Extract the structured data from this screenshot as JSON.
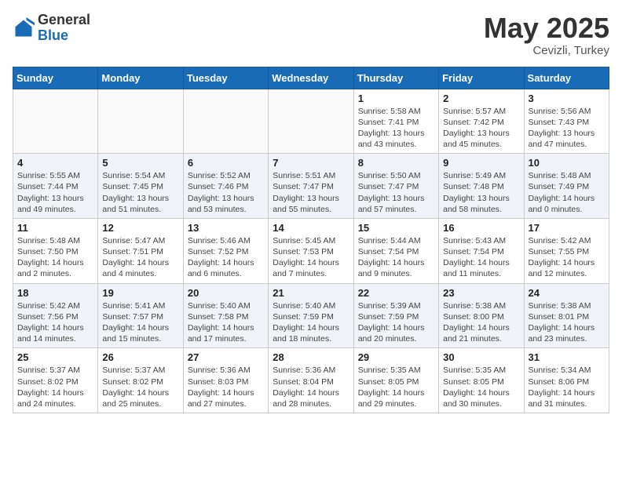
{
  "header": {
    "logo_general": "General",
    "logo_blue": "Blue",
    "month_year": "May 2025",
    "location": "Cevizli, Turkey"
  },
  "days_of_week": [
    "Sunday",
    "Monday",
    "Tuesday",
    "Wednesday",
    "Thursday",
    "Friday",
    "Saturday"
  ],
  "weeks": [
    [
      {
        "day": "",
        "detail": ""
      },
      {
        "day": "",
        "detail": ""
      },
      {
        "day": "",
        "detail": ""
      },
      {
        "day": "",
        "detail": ""
      },
      {
        "day": "1",
        "detail": "Sunrise: 5:58 AM\nSunset: 7:41 PM\nDaylight: 13 hours\nand 43 minutes."
      },
      {
        "day": "2",
        "detail": "Sunrise: 5:57 AM\nSunset: 7:42 PM\nDaylight: 13 hours\nand 45 minutes."
      },
      {
        "day": "3",
        "detail": "Sunrise: 5:56 AM\nSunset: 7:43 PM\nDaylight: 13 hours\nand 47 minutes."
      }
    ],
    [
      {
        "day": "4",
        "detail": "Sunrise: 5:55 AM\nSunset: 7:44 PM\nDaylight: 13 hours\nand 49 minutes."
      },
      {
        "day": "5",
        "detail": "Sunrise: 5:54 AM\nSunset: 7:45 PM\nDaylight: 13 hours\nand 51 minutes."
      },
      {
        "day": "6",
        "detail": "Sunrise: 5:52 AM\nSunset: 7:46 PM\nDaylight: 13 hours\nand 53 minutes."
      },
      {
        "day": "7",
        "detail": "Sunrise: 5:51 AM\nSunset: 7:47 PM\nDaylight: 13 hours\nand 55 minutes."
      },
      {
        "day": "8",
        "detail": "Sunrise: 5:50 AM\nSunset: 7:47 PM\nDaylight: 13 hours\nand 57 minutes."
      },
      {
        "day": "9",
        "detail": "Sunrise: 5:49 AM\nSunset: 7:48 PM\nDaylight: 13 hours\nand 58 minutes."
      },
      {
        "day": "10",
        "detail": "Sunrise: 5:48 AM\nSunset: 7:49 PM\nDaylight: 14 hours\nand 0 minutes."
      }
    ],
    [
      {
        "day": "11",
        "detail": "Sunrise: 5:48 AM\nSunset: 7:50 PM\nDaylight: 14 hours\nand 2 minutes."
      },
      {
        "day": "12",
        "detail": "Sunrise: 5:47 AM\nSunset: 7:51 PM\nDaylight: 14 hours\nand 4 minutes."
      },
      {
        "day": "13",
        "detail": "Sunrise: 5:46 AM\nSunset: 7:52 PM\nDaylight: 14 hours\nand 6 minutes."
      },
      {
        "day": "14",
        "detail": "Sunrise: 5:45 AM\nSunset: 7:53 PM\nDaylight: 14 hours\nand 7 minutes."
      },
      {
        "day": "15",
        "detail": "Sunrise: 5:44 AM\nSunset: 7:54 PM\nDaylight: 14 hours\nand 9 minutes."
      },
      {
        "day": "16",
        "detail": "Sunrise: 5:43 AM\nSunset: 7:54 PM\nDaylight: 14 hours\nand 11 minutes."
      },
      {
        "day": "17",
        "detail": "Sunrise: 5:42 AM\nSunset: 7:55 PM\nDaylight: 14 hours\nand 12 minutes."
      }
    ],
    [
      {
        "day": "18",
        "detail": "Sunrise: 5:42 AM\nSunset: 7:56 PM\nDaylight: 14 hours\nand 14 minutes."
      },
      {
        "day": "19",
        "detail": "Sunrise: 5:41 AM\nSunset: 7:57 PM\nDaylight: 14 hours\nand 15 minutes."
      },
      {
        "day": "20",
        "detail": "Sunrise: 5:40 AM\nSunset: 7:58 PM\nDaylight: 14 hours\nand 17 minutes."
      },
      {
        "day": "21",
        "detail": "Sunrise: 5:40 AM\nSunset: 7:59 PM\nDaylight: 14 hours\nand 18 minutes."
      },
      {
        "day": "22",
        "detail": "Sunrise: 5:39 AM\nSunset: 7:59 PM\nDaylight: 14 hours\nand 20 minutes."
      },
      {
        "day": "23",
        "detail": "Sunrise: 5:38 AM\nSunset: 8:00 PM\nDaylight: 14 hours\nand 21 minutes."
      },
      {
        "day": "24",
        "detail": "Sunrise: 5:38 AM\nSunset: 8:01 PM\nDaylight: 14 hours\nand 23 minutes."
      }
    ],
    [
      {
        "day": "25",
        "detail": "Sunrise: 5:37 AM\nSunset: 8:02 PM\nDaylight: 14 hours\nand 24 minutes."
      },
      {
        "day": "26",
        "detail": "Sunrise: 5:37 AM\nSunset: 8:02 PM\nDaylight: 14 hours\nand 25 minutes."
      },
      {
        "day": "27",
        "detail": "Sunrise: 5:36 AM\nSunset: 8:03 PM\nDaylight: 14 hours\nand 27 minutes."
      },
      {
        "day": "28",
        "detail": "Sunrise: 5:36 AM\nSunset: 8:04 PM\nDaylight: 14 hours\nand 28 minutes."
      },
      {
        "day": "29",
        "detail": "Sunrise: 5:35 AM\nSunset: 8:05 PM\nDaylight: 14 hours\nand 29 minutes."
      },
      {
        "day": "30",
        "detail": "Sunrise: 5:35 AM\nSunset: 8:05 PM\nDaylight: 14 hours\nand 30 minutes."
      },
      {
        "day": "31",
        "detail": "Sunrise: 5:34 AM\nSunset: 8:06 PM\nDaylight: 14 hours\nand 31 minutes."
      }
    ]
  ]
}
